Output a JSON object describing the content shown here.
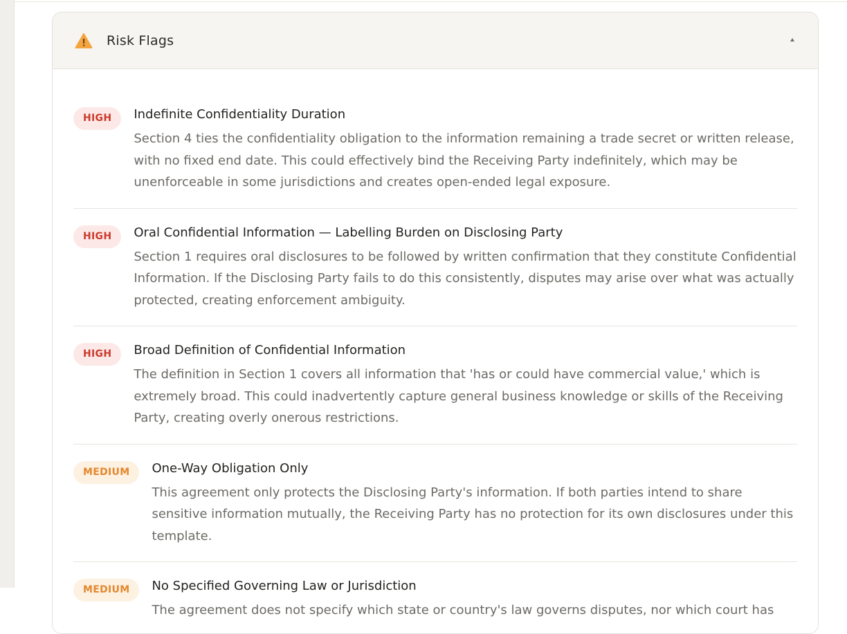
{
  "panel": {
    "title": "Risk Flags",
    "icon": "warning-icon",
    "collapse_icon": "chevron-up-icon"
  },
  "colors": {
    "high_bg": "#fce9e7",
    "high_text": "#cc3a2c",
    "medium_bg": "#fdf1e2",
    "medium_text": "#e4872c",
    "warning_icon": "#f5a540"
  },
  "flags": [
    {
      "severity": "HIGH",
      "title": "Indefinite Confidentiality Duration",
      "description": "Section 4 ties the confidentiality obligation to the information remaining a trade secret or written release, with no fixed end date. This could effectively bind the Receiving Party indefinitely, which may be unenforceable in some jurisdictions and creates open-ended legal exposure."
    },
    {
      "severity": "HIGH",
      "title": "Oral Confidential Information — Labelling Burden on Disclosing Party",
      "description": "Section 1 requires oral disclosures to be followed by written confirmation that they constitute Confidential Information. If the Disclosing Party fails to do this consistently, disputes may arise over what was actually protected, creating enforcement ambiguity."
    },
    {
      "severity": "HIGH",
      "title": "Broad Definition of Confidential Information",
      "description": "The definition in Section 1 covers all information that 'has or could have commercial value,' which is extremely broad. This could inadvertently capture general business knowledge or skills of the Receiving Party, creating overly onerous restrictions."
    },
    {
      "severity": "MEDIUM",
      "title": "One-Way Obligation Only",
      "description": "This agreement only protects the Disclosing Party's information. If both parties intend to share sensitive information mutually, the Receiving Party has no protection for its own disclosures under this template."
    },
    {
      "severity": "MEDIUM",
      "title": "No Specified Governing Law or Jurisdiction",
      "description": "The agreement does not specify which state or country's law governs disputes, nor which court has"
    }
  ]
}
